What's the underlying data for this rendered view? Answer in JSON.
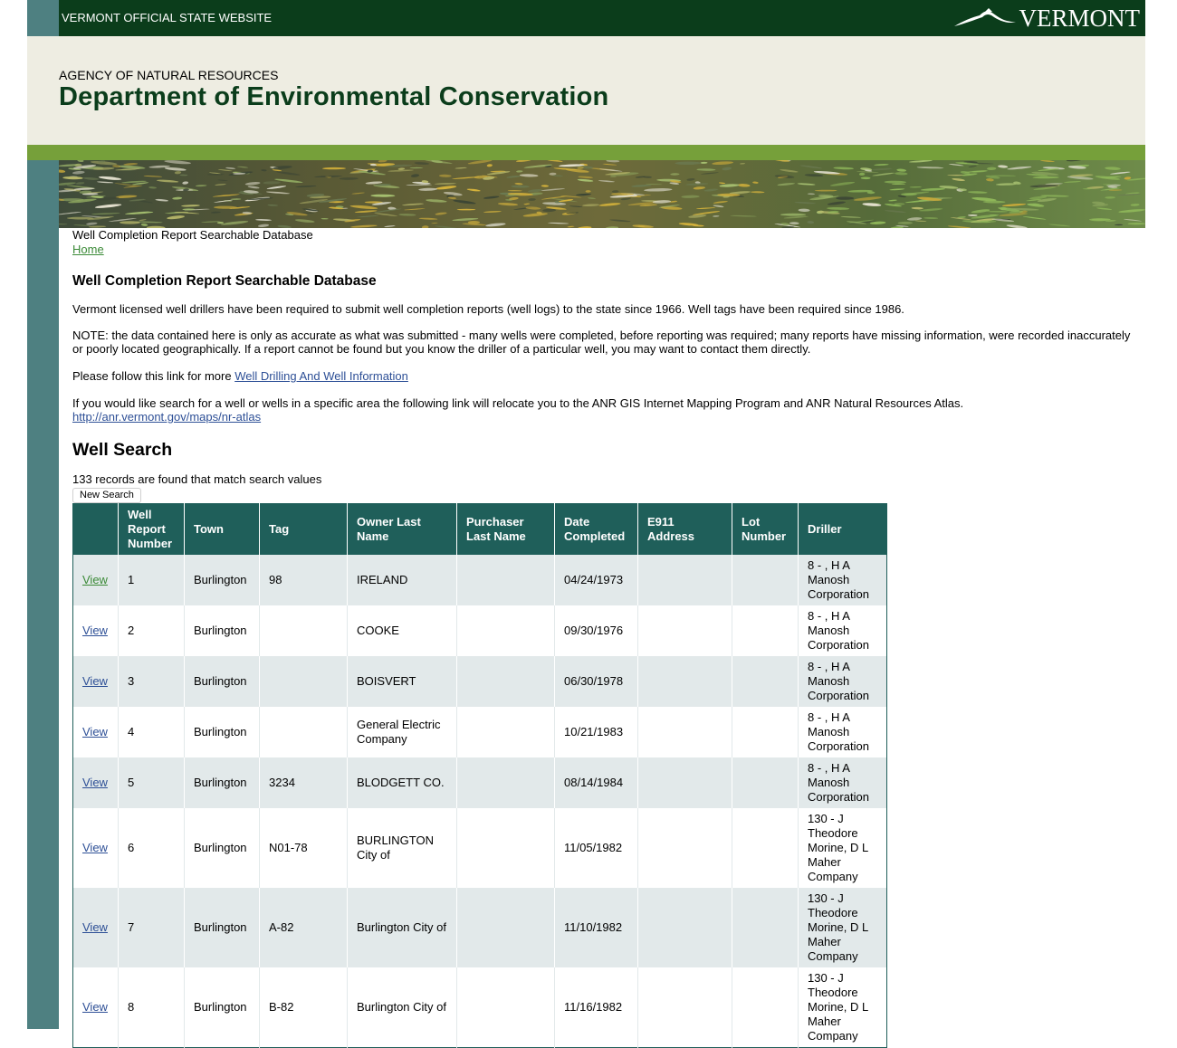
{
  "topbar": {
    "site_label": "VERMONT OFFICIAL STATE WEBSITE",
    "logo_text": "VERMONT",
    "logo_icon": "mountain-bird-logo-icon"
  },
  "header": {
    "agency": "AGENCY OF NATURAL RESOURCES",
    "department": "Department of Environmental Conservation"
  },
  "breadcrumb": {
    "current": "Well Completion Report Searchable Database",
    "home": "Home"
  },
  "intro": {
    "heading": "Well Completion Report Searchable Database",
    "p1": "Vermont licensed well drillers have been required to submit well completion reports (well logs) to the state since 1966. Well tags have been required since 1986.",
    "p2": "NOTE: the data contained here is only as accurate as what was submitted - many wells were completed, before reporting was required; many reports have missing information, were recorded inaccurately or poorly located geographically. If a report cannot be found but you know the driller of a particular well, you may want to contact them directly.",
    "p3_prefix": "Please follow this link for more ",
    "p3_link": "Well Drilling And Well Information",
    "p4": "If you would like search for a well or wells in a specific area the following link will relocate you to the ANR GIS Internet Mapping Program and ANR Natural Resources Atlas.",
    "p4_link": "http://anr.vermont.gov/maps/nr-atlas"
  },
  "search": {
    "heading": "Well Search",
    "count_text": "133 records are found that match search values",
    "new_search_label": "New Search"
  },
  "table": {
    "columns": [
      "",
      "Well Report Number",
      "Town",
      "Tag",
      "Owner Last Name",
      "Purchaser Last Name",
      "Date Completed",
      "E911 Address",
      "Lot Number",
      "Driller"
    ],
    "rows": [
      {
        "view": "View",
        "number": "1",
        "town": "Burlington",
        "tag": "98",
        "owner": "IRELAND",
        "purchaser": "",
        "date": "04/24/1973",
        "e911": "",
        "lot": "",
        "driller": "8 - , H A Manosh Corporation"
      },
      {
        "view": "View",
        "number": "2",
        "town": "Burlington",
        "tag": "",
        "owner": "COOKE",
        "purchaser": "",
        "date": "09/30/1976",
        "e911": "",
        "lot": "",
        "driller": "8 - , H A Manosh Corporation"
      },
      {
        "view": "View",
        "number": "3",
        "town": "Burlington",
        "tag": "",
        "owner": "BOISVERT",
        "purchaser": "",
        "date": "06/30/1978",
        "e911": "",
        "lot": "",
        "driller": "8 - , H A Manosh Corporation"
      },
      {
        "view": "View",
        "number": "4",
        "town": "Burlington",
        "tag": "",
        "owner": "General Electric Company",
        "purchaser": "",
        "date": "10/21/1983",
        "e911": "",
        "lot": "",
        "driller": "8 - , H A Manosh Corporation"
      },
      {
        "view": "View",
        "number": "5",
        "town": "Burlington",
        "tag": "3234",
        "owner": "BLODGETT CO.",
        "purchaser": "",
        "date": "08/14/1984",
        "e911": "",
        "lot": "",
        "driller": "8 - , H A Manosh Corporation"
      },
      {
        "view": "View",
        "number": "6",
        "town": "Burlington",
        "tag": "N01-78",
        "owner": "BURLINGTON City of",
        "purchaser": "",
        "date": "11/05/1982",
        "e911": "",
        "lot": "",
        "driller": "130 - J Theodore Morine, D L Maher Company"
      },
      {
        "view": "View",
        "number": "7",
        "town": "Burlington",
        "tag": "A-82",
        "owner": "Burlington City of",
        "purchaser": "",
        "date": "11/10/1982",
        "e911": "",
        "lot": "",
        "driller": "130 - J Theodore Morine, D L Maher Company"
      },
      {
        "view": "View",
        "number": "8",
        "town": "Burlington",
        "tag": "B-82",
        "owner": "Burlington City of",
        "purchaser": "",
        "date": "11/16/1982",
        "e911": "",
        "lot": "",
        "driller": "130 - J Theodore Morine, D L Maher Company"
      }
    ]
  },
  "colors": {
    "topbar_bg": "#0b3d1b",
    "header_bg": "#eeede2",
    "green_bar": "#76a03a",
    "left_strip": "#4e8081",
    "table_header": "#1f5f5a",
    "row_alt": "#e2e9ea",
    "link": "#2d4f96",
    "visited_link": "#3b8a37"
  }
}
